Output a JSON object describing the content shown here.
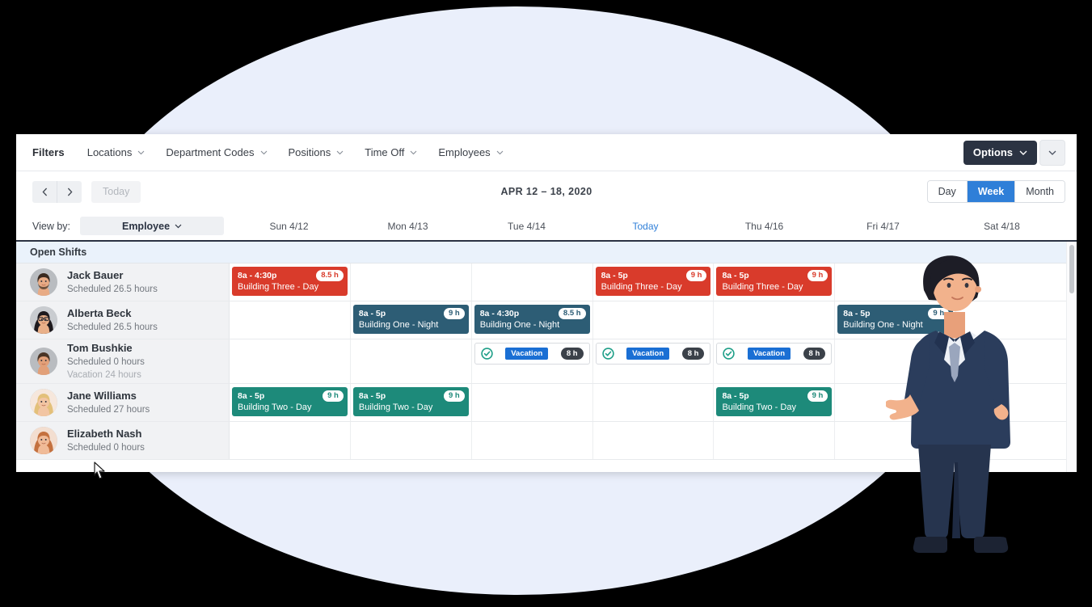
{
  "filter_bar": {
    "filters_label": "Filters",
    "items": [
      {
        "label": "Locations"
      },
      {
        "label": "Department Codes"
      },
      {
        "label": "Positions"
      },
      {
        "label": "Time Off"
      },
      {
        "label": "Employees"
      }
    ],
    "options_label": "Options"
  },
  "nav": {
    "today_label": "Today",
    "date_range": "APR 12 – 18, 2020",
    "views": [
      {
        "label": "Day",
        "active": false
      },
      {
        "label": "Week",
        "active": true
      },
      {
        "label": "Month",
        "active": false
      }
    ]
  },
  "viewby": {
    "label": "View by:",
    "value": "Employee"
  },
  "days": [
    {
      "label": "Sun 4/12",
      "today": false
    },
    {
      "label": "Mon 4/13",
      "today": false
    },
    {
      "label": "Tue 4/14",
      "today": false
    },
    {
      "label": "Today",
      "today": true
    },
    {
      "label": "Thu 4/16",
      "today": false
    },
    {
      "label": "Fri 4/17",
      "today": false
    },
    {
      "label": "Sat 4/18",
      "today": false
    }
  ],
  "open_shifts_label": "Open Shifts",
  "employees": [
    {
      "name": "Jack Bauer",
      "scheduled": "Scheduled 26.5 hours",
      "vacation": "",
      "cells": [
        {
          "type": "shift",
          "color": "red",
          "time": "8a - 4:30p",
          "position": "Building Three - Day",
          "hours": "8.5 h"
        },
        {
          "type": "empty"
        },
        {
          "type": "empty"
        },
        {
          "type": "shift",
          "color": "red",
          "time": "8a - 5p",
          "position": "Building Three - Day",
          "hours": "9 h"
        },
        {
          "type": "shift",
          "color": "red",
          "time": "8a - 5p",
          "position": "Building Three - Day",
          "hours": "9 h"
        },
        {
          "type": "empty"
        },
        {
          "type": "empty"
        }
      ]
    },
    {
      "name": "Alberta Beck",
      "scheduled": "Scheduled 26.5 hours",
      "vacation": "",
      "cells": [
        {
          "type": "empty"
        },
        {
          "type": "shift",
          "color": "navy",
          "time": "8a - 5p",
          "position": "Building One - Night",
          "hours": "9 h"
        },
        {
          "type": "shift",
          "color": "navy",
          "time": "8a - 4:30p",
          "position": "Building One - Night",
          "hours": "8.5 h"
        },
        {
          "type": "empty"
        },
        {
          "type": "empty"
        },
        {
          "type": "shift",
          "color": "navy",
          "time": "8a - 5p",
          "position": "Building One - Night",
          "hours": "9 h"
        },
        {
          "type": "empty"
        }
      ]
    },
    {
      "name": "Tom Bushkie",
      "scheduled": "Scheduled 0 hours",
      "vacation": "Vacation 24 hours",
      "cells": [
        {
          "type": "empty"
        },
        {
          "type": "empty"
        },
        {
          "type": "timeoff",
          "tag": "Vacation",
          "hours": "8 h"
        },
        {
          "type": "timeoff",
          "tag": "Vacation",
          "hours": "8 h"
        },
        {
          "type": "timeoff",
          "tag": "Vacation",
          "hours": "8 h"
        },
        {
          "type": "empty"
        },
        {
          "type": "empty"
        }
      ]
    },
    {
      "name": "Jane Williams",
      "scheduled": "Scheduled 27 hours",
      "vacation": "",
      "cells": [
        {
          "type": "shift",
          "color": "teal",
          "time": "8a - 5p",
          "position": "Building Two - Day",
          "hours": "9 h"
        },
        {
          "type": "shift",
          "color": "teal",
          "time": "8a - 5p",
          "position": "Building Two - Day",
          "hours": "9 h"
        },
        {
          "type": "empty"
        },
        {
          "type": "empty"
        },
        {
          "type": "shift",
          "color": "teal",
          "time": "8a - 5p",
          "position": "Building Two - Day",
          "hours": "9 h"
        },
        {
          "type": "empty"
        },
        {
          "type": "empty"
        }
      ]
    },
    {
      "name": "Elizabeth Nash",
      "scheduled": "Scheduled 0 hours",
      "vacation": "",
      "cells": [
        {
          "type": "empty"
        },
        {
          "type": "empty"
        },
        {
          "type": "empty"
        },
        {
          "type": "empty"
        },
        {
          "type": "empty"
        },
        {
          "type": "empty"
        },
        {
          "type": "empty"
        }
      ]
    }
  ],
  "colors": {
    "accent_blue": "#2f7fd8",
    "shift_red": "#d93b2b",
    "shift_navy": "#2d5d75",
    "shift_teal": "#1d8a7a",
    "dark": "#2b3342",
    "background_ellipse": "#eaeffb"
  }
}
